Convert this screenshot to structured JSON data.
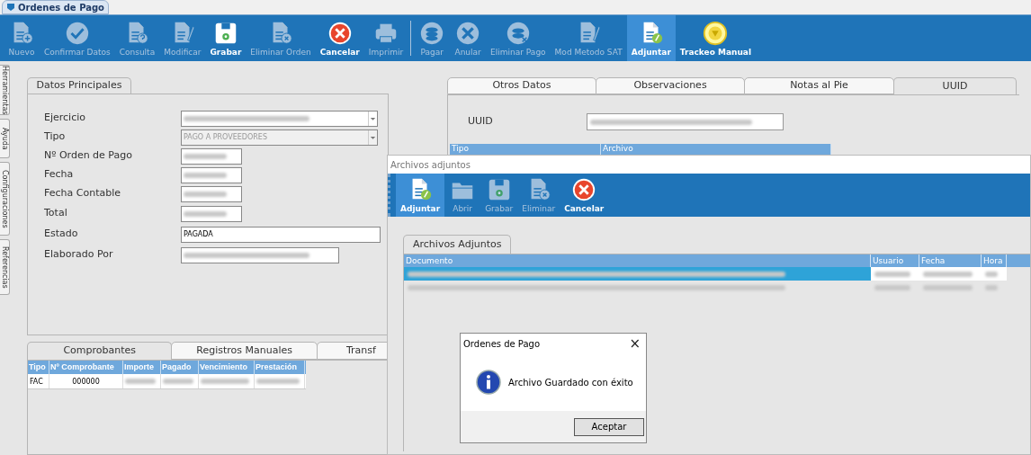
{
  "window": {
    "title": "Ordenes de Pago"
  },
  "toolbar": [
    {
      "label": "Nuevo",
      "disabled": true,
      "selected": false
    },
    {
      "label": "Confirmar Datos",
      "disabled": true,
      "selected": false
    },
    {
      "label": "Consulta",
      "disabled": true,
      "selected": false
    },
    {
      "label": "Modificar",
      "disabled": true,
      "selected": false
    },
    {
      "label": "Grabar",
      "disabled": false,
      "selected": false
    },
    {
      "label": "Eliminar Orden",
      "disabled": true,
      "selected": false
    },
    {
      "label": "Cancelar",
      "disabled": false,
      "selected": false
    },
    {
      "label": "Imprimir",
      "disabled": true,
      "selected": false
    },
    {
      "label": "Pagar",
      "disabled": true,
      "selected": false
    },
    {
      "label": "Anular",
      "disabled": true,
      "selected": false
    },
    {
      "label": "Eliminar Pago",
      "disabled": true,
      "selected": false
    },
    {
      "label": "Mod Metodo SAT",
      "disabled": true,
      "selected": false
    },
    {
      "label": "Adjuntar",
      "disabled": false,
      "selected": true
    },
    {
      "label": "Trackeo Manual",
      "disabled": false,
      "selected": false
    }
  ],
  "side_tabs": [
    "Herramientas",
    "Ayuda",
    "Configuraciones",
    "Referencias"
  ],
  "main_tabs": [
    {
      "label": "Datos Principales",
      "selected": true
    }
  ],
  "fields": [
    {
      "label": "Ejercicio",
      "kind": "dropdown",
      "redacted": true
    },
    {
      "label": "Tipo",
      "kind": "dropdown",
      "value": "PAGO A PROVEEDORES"
    },
    {
      "label": "Nº Orden de Pago",
      "kind": "short",
      "redacted": true
    },
    {
      "label": "Fecha",
      "kind": "short",
      "redacted": true
    },
    {
      "label": "Fecha Contable",
      "kind": "short",
      "redacted": true
    },
    {
      "label": "Total",
      "kind": "short",
      "redacted": true
    },
    {
      "label": "Estado",
      "kind": "wide",
      "value": "PAGADA"
    },
    {
      "label": "Elaborado Por",
      "kind": "medium",
      "redacted": true
    }
  ],
  "right_tabs": [
    {
      "label": "Otros Datos",
      "selected": false
    },
    {
      "label": "Observaciones",
      "selected": false
    },
    {
      "label": "Notas al Pie",
      "selected": false
    },
    {
      "label": "UUID",
      "selected": true
    }
  ],
  "uuid": {
    "label": "UUID",
    "redacted": true
  },
  "uuid_table": {
    "columns": [
      "Tipo",
      "Archivo"
    ]
  },
  "bottom_tabs": [
    {
      "label": "Comprobantes",
      "selected": true
    },
    {
      "label": "Registros Manuales",
      "selected": false
    },
    {
      "label": "Transf",
      "selected": false
    }
  ],
  "comprobantes": {
    "columns": [
      "Tipo",
      "Nº Comprobante",
      "Importe",
      "Pagado",
      "Vencimiento",
      "Prestación"
    ],
    "rows": [
      {
        "cells": [
          "FAC",
          "000000"
        ]
      }
    ]
  },
  "attachments_dialog": {
    "title": "Archivos adjuntos",
    "toolbar": [
      {
        "label": "Adjuntar",
        "disabled": false,
        "selected": true
      },
      {
        "label": "Abrir",
        "disabled": true,
        "selected": false
      },
      {
        "label": "Grabar",
        "disabled": true,
        "selected": false
      },
      {
        "label": "Eliminar",
        "disabled": true,
        "selected": false
      },
      {
        "label": "Cancelar",
        "disabled": false,
        "selected": false
      }
    ],
    "tab": "Archivos Adjuntos",
    "columns": [
      "Documento",
      "Usuario",
      "Fecha",
      "Hora"
    ],
    "rows": [
      {
        "selected": true
      },
      {
        "selected": false
      }
    ]
  },
  "message_box": {
    "title": "Ordenes de Pago",
    "close": "×",
    "message": "Archivo Guardado con éxito",
    "button": "Aceptar"
  }
}
